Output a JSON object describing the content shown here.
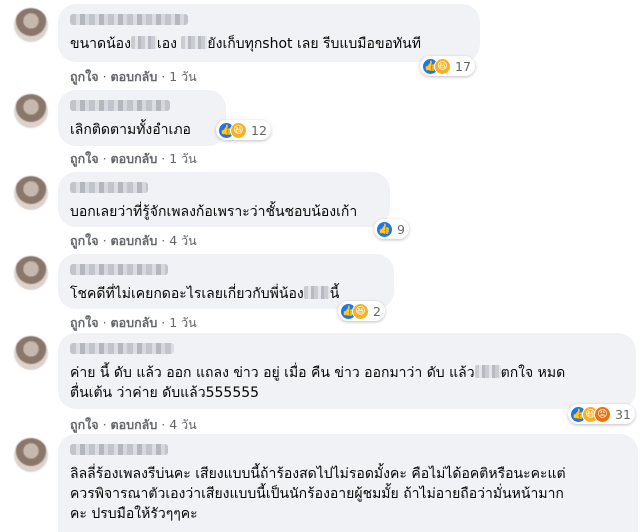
{
  "labels": {
    "like": "ถูกใจ",
    "reply": "ตอบกลับ",
    "sep": "·"
  },
  "comments": [
    {
      "time": "1 วัน",
      "text_a": "ขนาดน้อง",
      "text_b": "เอง",
      "text_c": "ยังเก็บทุกshot เลย รีบแบมือขอทันที",
      "reactions": [
        "like-icon",
        "haha-icon"
      ],
      "count": "17"
    },
    {
      "time": "1 วัน",
      "text": "เลิกติดตามทั้งอำเภอ",
      "reactions": [
        "like-icon",
        "haha-icon"
      ],
      "count": "12"
    },
    {
      "time": "4 วัน",
      "text": "บอกเลยว่าที่รู้จักเพลงก้อเพราะว่าชั้นชอบน้องเก้า",
      "reactions": [
        "like-icon"
      ],
      "count": "9"
    },
    {
      "time": "1 วัน",
      "text_a": "โชคดีที่ไม่เคยกดอะไรเลยเกี่ยวกับพี่น้อง",
      "text_b": "นี้",
      "reactions": [
        "like-icon",
        "haha-icon"
      ],
      "count": "2"
    },
    {
      "time": "4 วัน",
      "line1_a": "ค่าย นี้ ดับ แล้ว ออก แถลง ข่าว อยู่ เมื่อ คืน ข่าว ออกมาว่า ดับ แล้ว",
      "line1_b": "ตกใจ หมด",
      "line2": "ตื่นเต้น ว่าค่าย ดับแล้ว555555",
      "reactions": [
        "like-icon",
        "haha-icon",
        "angry-icon"
      ],
      "count": "31"
    },
    {
      "line1": "ลิลลี่ร้องเพลงรีบ่นคะ เสียงแบบนี้ถ้าร้องสดไปไม่รอดมั้งคะ คือไม่ได้อคติหรือนะคะแต่",
      "line2": "ควรพิจารณาตัวเองว่าเสียงแบบนี้เป็นนักร้องอายผู้ชมมั้ย ถ้าไม่อายถือว่ามั่นหน้ามาก",
      "line3": "คะ ปรบมือให้รัวๆๆคะ"
    }
  ]
}
